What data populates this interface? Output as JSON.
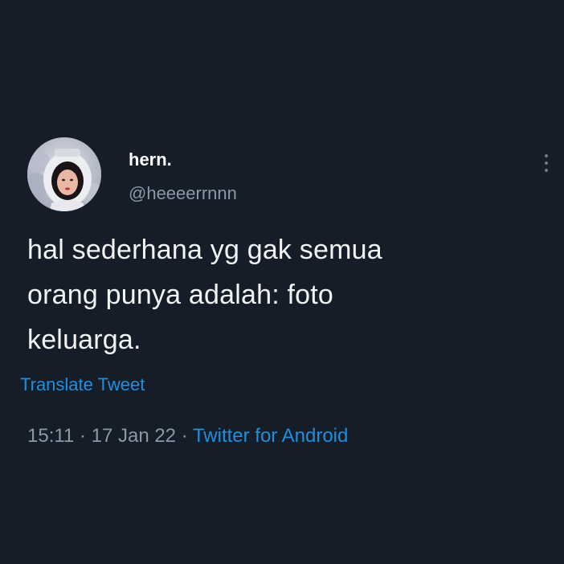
{
  "tweet": {
    "author": {
      "display_name": "hern.",
      "handle": "@heeeerrnnn",
      "avatar_icon": "profile-photo"
    },
    "more_icon": "more-vertical-icon",
    "text_lines": [
      "hal sederhana yg gak semua",
      "orang punya adalah: foto",
      "keluarga."
    ],
    "translate_label": "Translate Tweet",
    "time": "15:11",
    "separator": " · ",
    "date": "17 Jan 22",
    "source": "Twitter for Android"
  },
  "colors": {
    "background": "#151d28",
    "link": "#1d8fe0",
    "muted": "#8b98a5",
    "text": "#f1f3f4"
  }
}
